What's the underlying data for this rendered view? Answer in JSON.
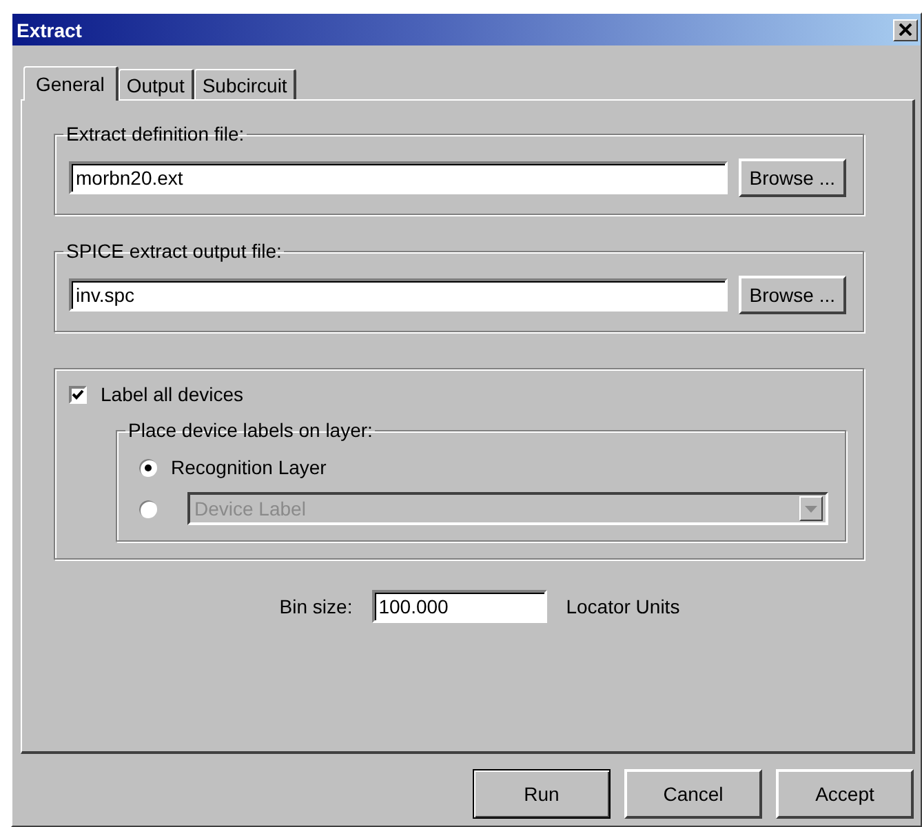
{
  "window": {
    "title": "Extract"
  },
  "tabs": [
    {
      "label": "General",
      "selected": true
    },
    {
      "label": "Output",
      "selected": false
    },
    {
      "label": "Subcircuit",
      "selected": false
    }
  ],
  "file_groups": [
    {
      "label": "Extract definition file:",
      "value": "morbn20.ext",
      "button": "Browse ..."
    },
    {
      "label": "SPICE extract output file:",
      "value": "inv.spc",
      "button": "Browse ..."
    }
  ],
  "label_devices": {
    "label": "Label all devices",
    "checked": true,
    "layer_group": {
      "label": "Place device labels on layer:",
      "options": [
        {
          "kind": "text",
          "label": "Recognition Layer",
          "selected": true
        },
        {
          "kind": "dropdown",
          "value": "Device Label",
          "disabled": true,
          "selected": false
        }
      ]
    }
  },
  "bin_size": {
    "label": "Bin size:",
    "value": "100.000",
    "units": "Locator Units"
  },
  "buttons": [
    {
      "label": "Run",
      "default": true
    },
    {
      "label": "Cancel",
      "default": false
    },
    {
      "label": "Accept",
      "default": false
    }
  ]
}
